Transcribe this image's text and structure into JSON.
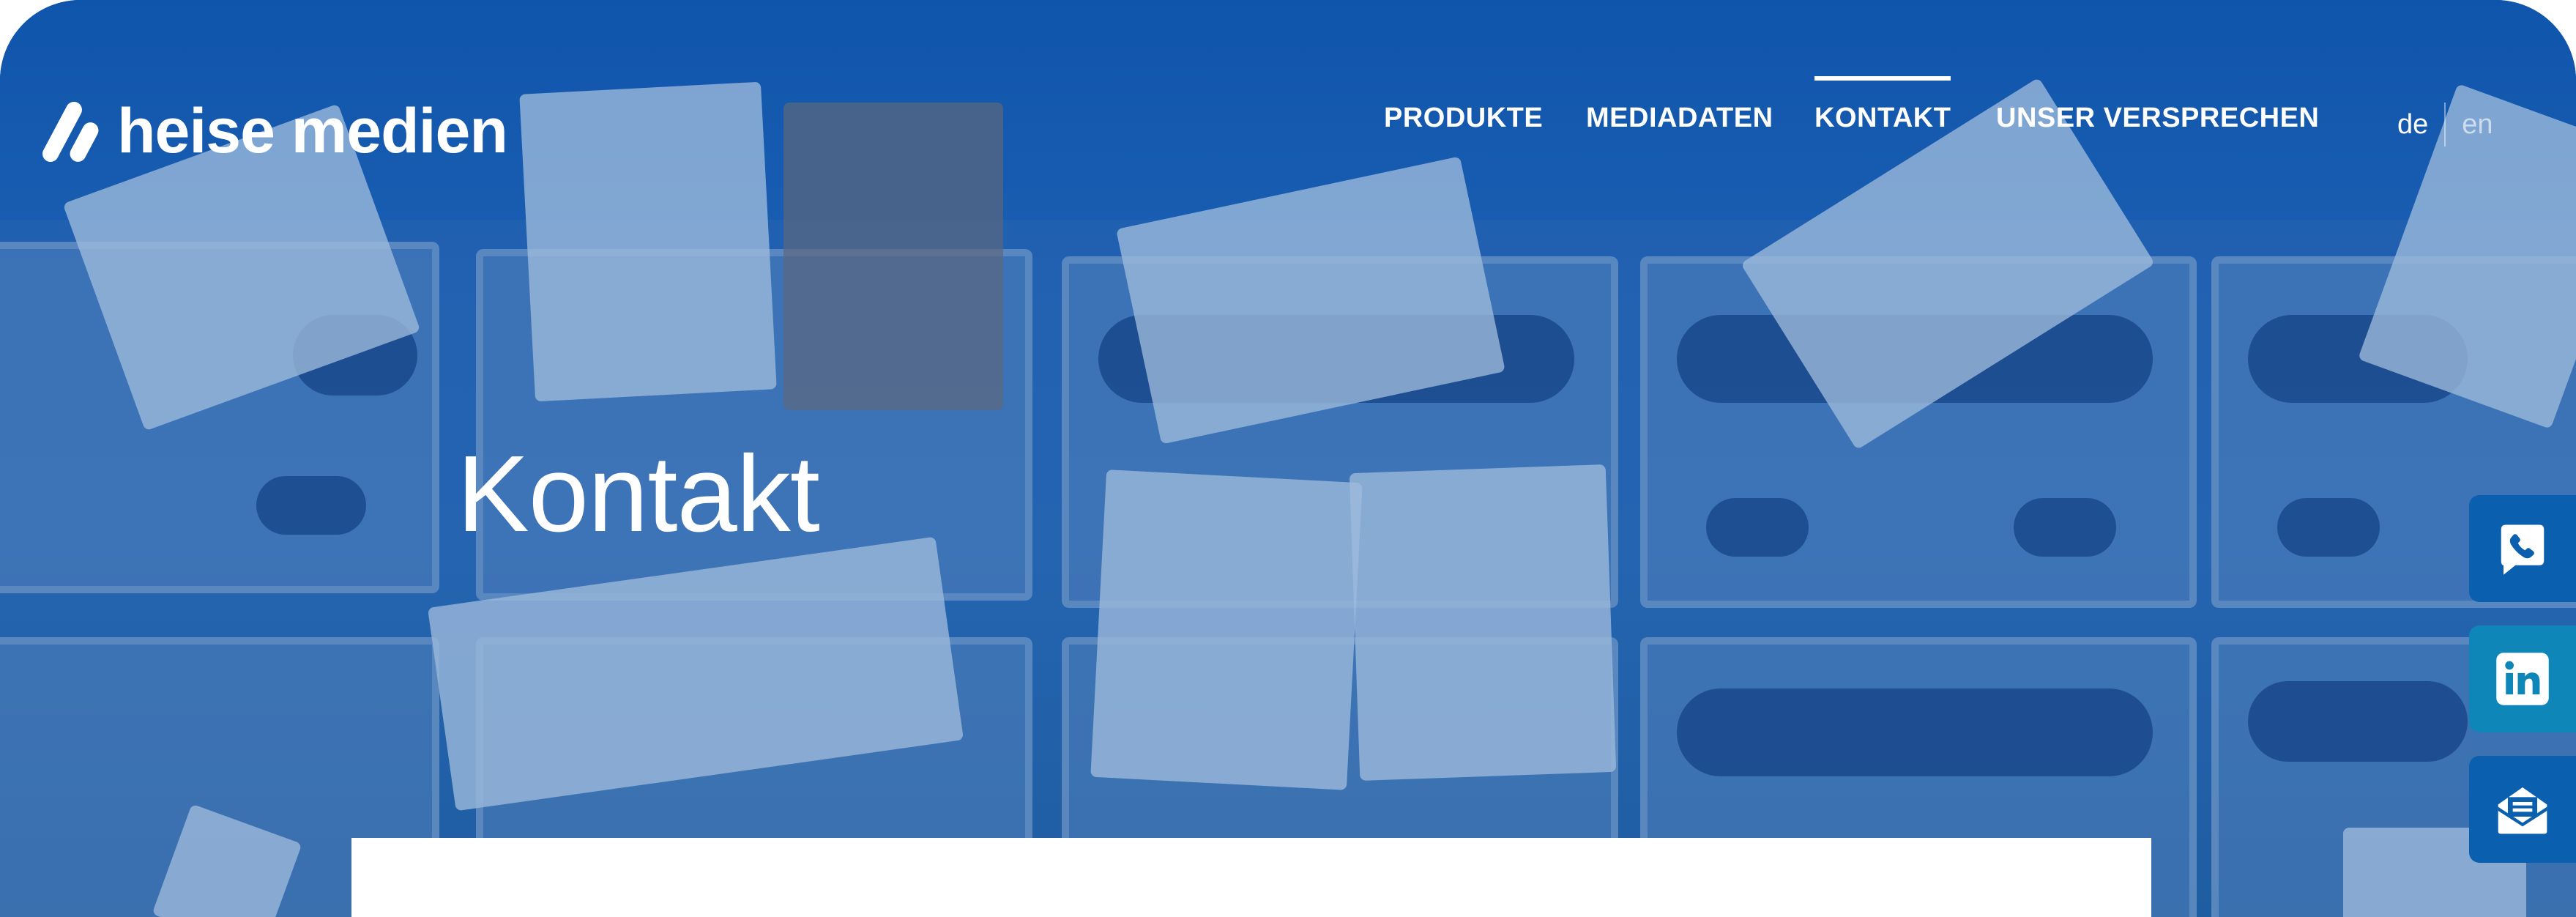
{
  "brand": {
    "name": "heise medien"
  },
  "nav": {
    "items": [
      {
        "label": "PRODUKTE",
        "active": false
      },
      {
        "label": "MEDIADATEN",
        "active": false
      },
      {
        "label": "KONTAKT",
        "active": true
      },
      {
        "label": "UNSER VERSPRECHEN",
        "active": false
      }
    ]
  },
  "language": {
    "current": "de",
    "other": "en"
  },
  "hero": {
    "title": "Kontakt"
  },
  "side_actions": [
    {
      "icon": "phone-icon"
    },
    {
      "icon": "linkedin-icon"
    },
    {
      "icon": "newsletter-icon"
    }
  ],
  "colors": {
    "primary": "#0a5fae",
    "linkedin": "#0e86b8",
    "overlay": "#1a5aa8"
  }
}
